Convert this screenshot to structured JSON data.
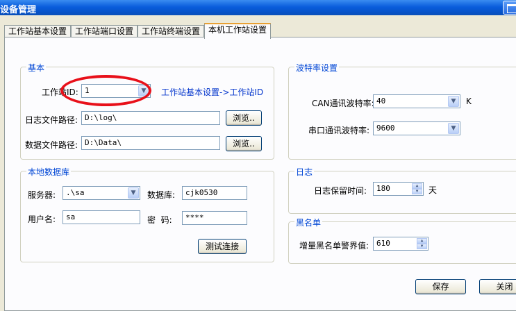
{
  "window": {
    "title": "设备管理"
  },
  "tabs": [
    {
      "label": "工作站基本设置"
    },
    {
      "label": "工作站端口设置"
    },
    {
      "label": "工作站终端设置"
    },
    {
      "label": "本机工作站设置",
      "active": true
    }
  ],
  "basic": {
    "legend": "基本",
    "station_id_label": "工作站ID:",
    "station_id_value": "1",
    "station_id_link": "工作站基本设置->工作站ID",
    "log_path_label": "日志文件路径:",
    "log_path_value": "D:\\log\\",
    "data_path_label": "数据文件路径:",
    "data_path_value": "D:\\Data\\",
    "browse_label": "浏览.."
  },
  "local_db": {
    "legend": "本地数据库",
    "server_label": "服务器:",
    "server_value": ".\\sa",
    "database_label": "数据库:",
    "database_value": "cjk0530",
    "username_label": "用户名:",
    "username_value": "sa",
    "password_label": "密  码:",
    "password_value": "****",
    "test_button": "测试连接"
  },
  "baud": {
    "legend": "波特率设置",
    "can_label": "CAN通讯波特率:",
    "can_value": "40",
    "can_unit": "K",
    "serial_label": "串口通讯波特率:",
    "serial_value": "9600"
  },
  "log": {
    "legend": "日志",
    "retention_label": "日志保留时间:",
    "retention_value": "180",
    "retention_unit": "天"
  },
  "blacklist": {
    "legend": "黑名单",
    "threshold_label": "增量黑名单警界值:",
    "threshold_value": "610"
  },
  "footer": {
    "save_button": "保存",
    "close_button": "关闭"
  },
  "colors": {
    "annotation": "#e8101a",
    "legend": "#0046d5",
    "titlebar": "#0a5ddc"
  }
}
